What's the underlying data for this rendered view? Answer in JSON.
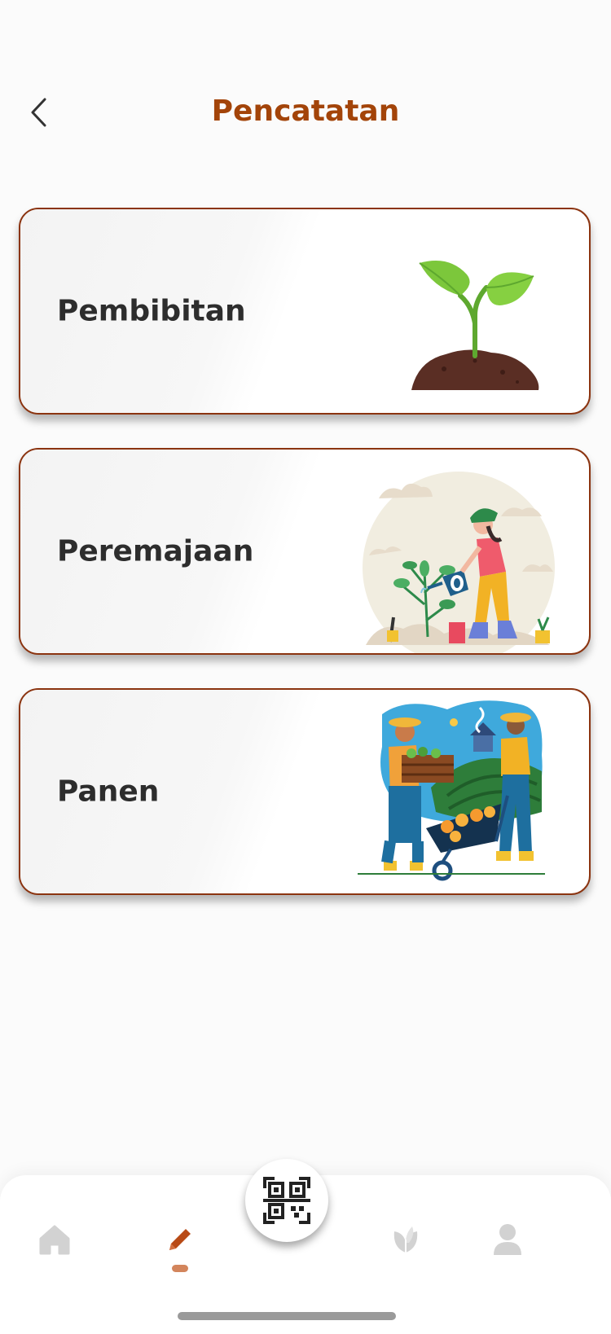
{
  "header": {
    "title": "Pencatatan",
    "back_icon": "chevron-left-icon",
    "title_color": "#a34409"
  },
  "cards": [
    {
      "label": "Pembibitan",
      "illustration": "seedling-illustration"
    },
    {
      "label": "Peremajaan",
      "illustration": "gardener-watering-illustration"
    },
    {
      "label": "Panen",
      "illustration": "farmers-harvest-illustration"
    }
  ],
  "colors": {
    "accent": "#a34409",
    "card_border": "#8b3410",
    "nav_inactive": "#d2d2d2",
    "nav_active": "#b84a16"
  },
  "nav": {
    "items": [
      {
        "icon": "home-icon",
        "active": false
      },
      {
        "icon": "pencil-icon",
        "active": true
      },
      {
        "icon": "qr-scan-icon",
        "active": false
      },
      {
        "icon": "leaf-icon",
        "active": false
      },
      {
        "icon": "user-icon",
        "active": false
      }
    ]
  }
}
